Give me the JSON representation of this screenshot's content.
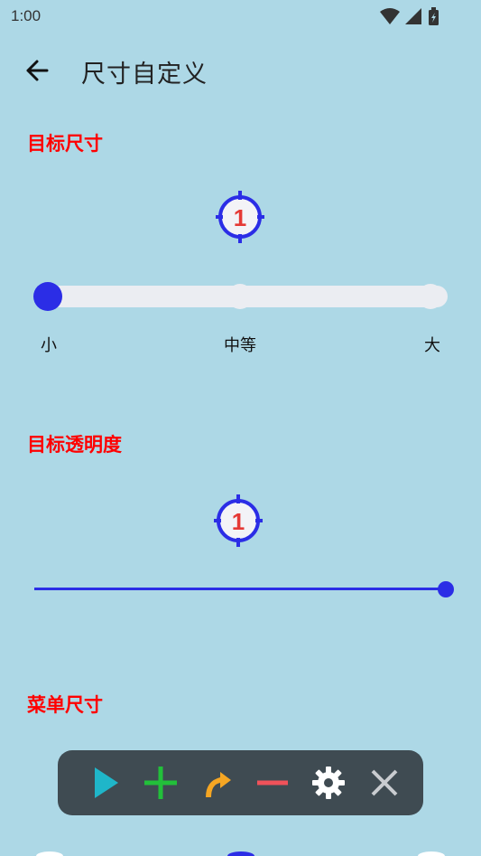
{
  "status_bar": {
    "time": "1:00",
    "icons": [
      "wifi-icon",
      "signal-icon",
      "battery-charging-icon"
    ]
  },
  "app_bar": {
    "back_icon": "arrow-left-icon",
    "title": "尺寸自定义"
  },
  "sections": {
    "target_size": {
      "title": "目标尺寸",
      "target_number": "1",
      "options": [
        "小",
        "中等",
        "大"
      ],
      "selected": "小"
    },
    "target_opacity": {
      "title": "目标透明度",
      "target_number": "1",
      "value_fraction": 1.0
    },
    "menu_size": {
      "title": "菜单尺寸"
    }
  },
  "toolbar": {
    "buttons": [
      "play-icon",
      "plus-icon",
      "swipe-arrow-icon",
      "minus-icon",
      "gear-icon",
      "close-icon"
    ]
  },
  "colors": {
    "background": "#add8e6",
    "section_title": "#ff0000",
    "accent_blue": "#2b2de6",
    "target_number": "#e53935",
    "toolbar_bg": "#3f4b52",
    "play": "#1fb6c9",
    "plus": "#22c03a",
    "swipe": "#f5a623",
    "minus": "#f0525a",
    "gear": "#ffffff",
    "close": "#c9ccd0"
  }
}
